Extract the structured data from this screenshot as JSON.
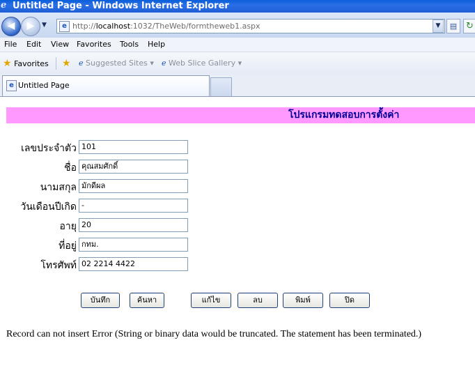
{
  "window": {
    "title": "Untitled Page - Windows Internet Explorer"
  },
  "address_bar": {
    "url_prefix": "http://",
    "url_host": "localhost",
    "url_rest": ":1032/TheWeb/formtheweb1.aspx"
  },
  "menu": {
    "items": [
      "File",
      "Edit",
      "View",
      "Favorites",
      "Tools",
      "Help"
    ]
  },
  "favorites_bar": {
    "favorites_label": "Favorites",
    "suggested_sites": "Suggested Sites ▾",
    "web_slice_gallery": "Web Slice Gallery ▾"
  },
  "tabs": {
    "active_label": "Untitled Page"
  },
  "page": {
    "heading": "โปรแกรมทดสอบการตั้งค่า",
    "fields": [
      {
        "label": "เลขประจำตัว",
        "value": "101"
      },
      {
        "label": "ชื่อ",
        "value": "คุณสมศักดิ์"
      },
      {
        "label": "นามสกุล",
        "value": "มักดีผล"
      },
      {
        "label": "วันเดือนปีเกิด",
        "value": "-"
      },
      {
        "label": "อายุ",
        "value": "20"
      },
      {
        "label": "ที่อยู่",
        "value": "กทม."
      },
      {
        "label": "โทรศัพท์",
        "value": "02 2214 4422"
      }
    ],
    "buttons": {
      "save": "บันทึก",
      "search": "ค้นหา",
      "edit": "แก้ไข",
      "delete": "ลบ",
      "print": "พิมพ์",
      "close": "ปิด"
    },
    "status_message": "Record can not insert Error (String or binary data would be truncated. The statement has been terminated.)"
  },
  "colors": {
    "heading_band": "#ff99ff",
    "heading_text": "#000099",
    "titlebar": "#2b6fe5"
  }
}
